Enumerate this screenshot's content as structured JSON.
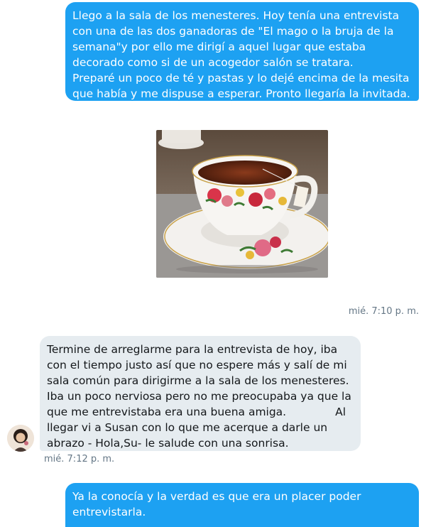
{
  "messages": [
    {
      "direction": "outgoing",
      "text": "Llego a la sala de los menesteres. Hoy tenía una entrevista con una de las dos ganadoras de \"El mago o la bruja de la semana\"y por ello me dirigí a aquel lugar que estaba decorado como si de un acogedor salón se tratara.\nPreparé un poco de té y pastas y lo dejé encima de la mesita que había y me dispuse a esperar. Pronto llegaría la invitada."
    },
    {
      "direction": "outgoing",
      "media": "teacup-photo",
      "timestamp": "mié. 7:10 p. m."
    },
    {
      "direction": "incoming",
      "text": "Termine de arreglarme para la entrevista de hoy, iba con el tiempo justo así que no espere más y salí de mi sala común para dirigirme a la sala de los menesteres. Iba un poco nerviosa pero no me preocupaba ya que la que me entrevistaba era una buena amiga.              Al llegar vi a Susan con lo que me acerque a darle un abrazo - Hola,Su- le salude con una sonrisa.",
      "timestamp": "mié. 7:12 p. m."
    },
    {
      "direction": "outgoing",
      "text": "Ya la conocía y la verdad es que era un placer poder entrevistarla.\n\n-Hola linda-le dijo con una tierna sonrisa."
    }
  ],
  "colors": {
    "outgoing_bubble": "#1da1f2",
    "incoming_bubble": "#e6ecf0",
    "timestamp": "#657786"
  }
}
